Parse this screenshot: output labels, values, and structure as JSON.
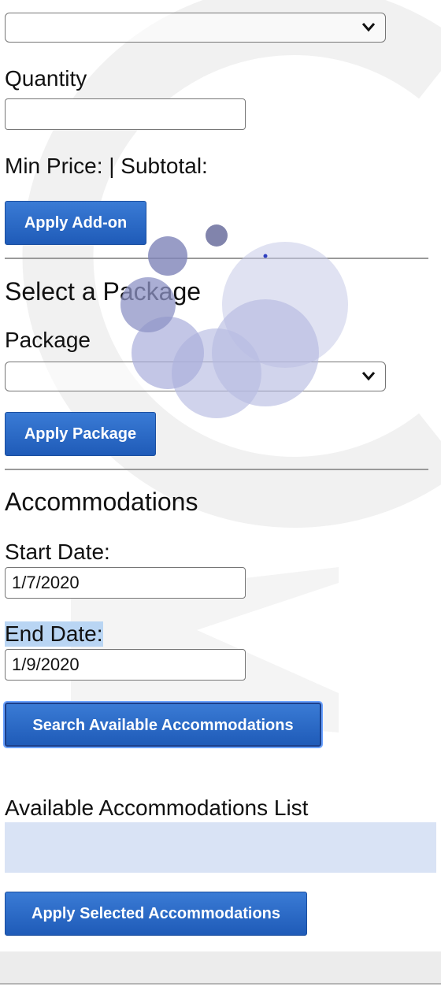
{
  "addon": {
    "select_value": "",
    "quantity_label": "Quantity",
    "quantity_value": "",
    "price_line": "Min Price: | Subtotal:",
    "apply_button": "Apply Add-on"
  },
  "package": {
    "heading": "Select a Package",
    "label": "Package",
    "select_value": "",
    "apply_button": "Apply Package"
  },
  "accommodations": {
    "heading": "Accommodations",
    "start_label": "Start Date:",
    "start_value": "1/7/2020",
    "end_label": "End Date:",
    "end_value": "1/9/2020",
    "search_button": "Search Available Accommodations",
    "list_heading": "Available Accommodations List",
    "apply_button": "Apply Selected Accommodations"
  },
  "icons": {
    "dropdown": "chevron-down-icon",
    "loading": "loading-spinner-icon"
  },
  "colors": {
    "button_blue": "#2563c0",
    "list_background": "#d9e3f5",
    "selection_highlight": "#b9d5f3"
  }
}
